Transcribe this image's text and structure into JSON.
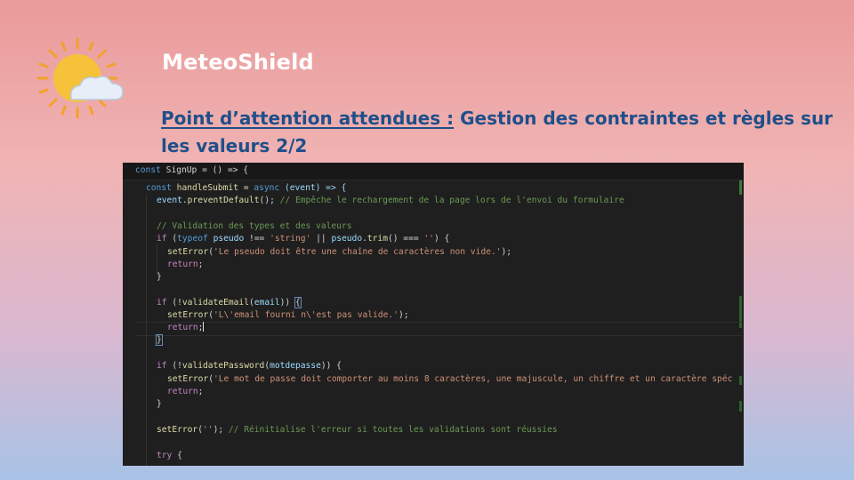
{
  "brand": {
    "name": "MeteoShield",
    "logo_icon": "sun-cloud-icon"
  },
  "heading": {
    "underlined": "Point d’attention attendues :",
    "rest": " Gestion des contraintes et règles sur les valeurs 2/2"
  },
  "code": {
    "lines": [
      [
        "const",
        " SignUp = () => {"
      ],
      [
        "const",
        " handleSubmit = ",
        "async",
        " (event) => {"
      ],
      [
        "event",
        ".",
        "preventDefault",
        "(); ",
        "// Empêche le rechargement de la page lors de l'envoi du formulaire"
      ],
      [
        "// Validation des types et des valeurs"
      ],
      [
        "if",
        " (",
        "typeof",
        " ",
        "pseudo",
        " !== ",
        "'string'",
        " || ",
        "pseudo",
        ".",
        "trim",
        "() === ",
        "''",
        ") {"
      ],
      [
        "setError",
        "(",
        "'Le pseudo doit être une chaîne de caractères non vide.'",
        ");"
      ],
      [
        "return",
        ";"
      ],
      [
        "}"
      ],
      [
        "if",
        " (!",
        "validateEmail",
        "(",
        "email",
        ")) ",
        "{"
      ],
      [
        "setError",
        "(",
        "'L\\'email fourni n\\'est pas valide.'",
        ");"
      ],
      [
        "return",
        ";"
      ],
      [
        "}"
      ],
      [
        "if",
        " (!",
        "validatePassword",
        "(",
        "motdepasse",
        ")) {"
      ],
      [
        "setError",
        "(",
        "'Le mot de passe doit comporter au moins 8 caractères, une majuscule, un chiffre et un caractère spéc"
      ],
      [
        "return",
        ";"
      ],
      [
        "}"
      ],
      [
        "setError",
        "(",
        "''",
        "); ",
        "// Réinitialise l'erreur si toutes les validations sont réussies"
      ],
      [
        "try",
        " {"
      ]
    ]
  },
  "colors": {
    "brand_text": "#ffffff",
    "heading_text": "#1f4f8a",
    "editor_bg": "#1f1f1f"
  }
}
